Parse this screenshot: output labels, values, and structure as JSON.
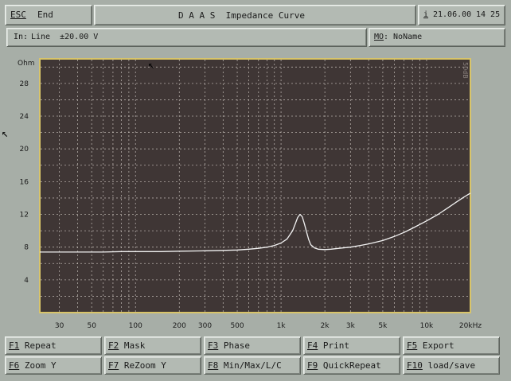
{
  "header": {
    "esc_key": "ESC",
    "esc_label": "End",
    "title": "D A A S  Impedance Curve",
    "info_icon": "i",
    "date": "21.06.00",
    "time": "14 25"
  },
  "input_bar": {
    "prefix": "In:",
    "text": "Line  ±20.00 V"
  },
  "mo_bar": {
    "key": "MO",
    "text": ": NoName"
  },
  "function_keys": [
    {
      "key": "F1",
      "label": "Repeat"
    },
    {
      "key": "F2",
      "label": "Mask"
    },
    {
      "key": "F3",
      "label": "Phase"
    },
    {
      "key": "F4",
      "label": "Print"
    },
    {
      "key": "F5",
      "label": "Export"
    },
    {
      "key": "F6",
      "label": "Zoom Y"
    },
    {
      "key": "F7",
      "label": "ReZoom Y"
    },
    {
      "key": "F8",
      "label": "Min/Max/L/C"
    },
    {
      "key": "F9",
      "label": "QuickRepeat"
    },
    {
      "key": "F10",
      "label": "load/save"
    }
  ],
  "colors": {
    "plot_background": "#3f3635",
    "plot_border": "#d8c46a",
    "grid": "#d9d2cc",
    "curve": "#f2f2f2"
  },
  "chart_data": {
    "type": "line",
    "title": "",
    "xlabel": "",
    "ylabel": "Ohm",
    "x_scale": "log",
    "xlim": [
      22,
      20000
    ],
    "ylim": [
      0,
      31
    ],
    "x_tick_labels": [
      {
        "value": 30,
        "label": "30"
      },
      {
        "value": 50,
        "label": "50"
      },
      {
        "value": 100,
        "label": "100"
      },
      {
        "value": 200,
        "label": "200"
      },
      {
        "value": 300,
        "label": "300"
      },
      {
        "value": 500,
        "label": "500"
      },
      {
        "value": 1000,
        "label": "1k"
      },
      {
        "value": 2000,
        "label": "2k"
      },
      {
        "value": 3000,
        "label": "3k"
      },
      {
        "value": 5000,
        "label": "5k"
      },
      {
        "value": 10000,
        "label": "10k"
      },
      {
        "value": 20000,
        "label": "20kHz"
      }
    ],
    "x_grid": [
      30,
      40,
      50,
      60,
      70,
      80,
      90,
      100,
      200,
      300,
      400,
      500,
      600,
      700,
      800,
      900,
      1000,
      2000,
      3000,
      4000,
      5000,
      6000,
      7000,
      8000,
      9000,
      10000,
      20000
    ],
    "y_ticks": [
      4,
      8,
      12,
      16,
      20,
      24,
      28
    ],
    "y_grid": [
      2,
      4,
      6,
      8,
      10,
      12,
      14,
      16,
      18,
      20,
      22,
      24,
      26,
      28,
      30
    ],
    "grid": true,
    "side_label": "50dB",
    "series": [
      {
        "x": [
          22,
          40,
          60,
          80,
          100,
          150,
          200,
          300,
          400,
          500,
          600,
          700,
          800,
          900,
          1000,
          1100,
          1200,
          1250,
          1300,
          1350,
          1400,
          1450,
          1500,
          1550,
          1600,
          1700,
          1800,
          2000,
          2200,
          2500,
          3000,
          3500,
          4000,
          5000,
          6000,
          7000,
          8000,
          10000,
          12000,
          14000,
          16000,
          18000,
          20000
        ],
        "y": [
          7.4,
          7.4,
          7.4,
          7.45,
          7.45,
          7.45,
          7.5,
          7.55,
          7.6,
          7.65,
          7.75,
          7.85,
          8.0,
          8.2,
          8.5,
          9.0,
          10.0,
          10.8,
          11.6,
          12.0,
          11.7,
          10.8,
          9.8,
          8.9,
          8.3,
          7.9,
          7.75,
          7.7,
          7.75,
          7.85,
          8.0,
          8.2,
          8.4,
          8.8,
          9.3,
          9.8,
          10.3,
          11.2,
          12.0,
          12.8,
          13.5,
          14.1,
          14.6
        ]
      }
    ]
  }
}
